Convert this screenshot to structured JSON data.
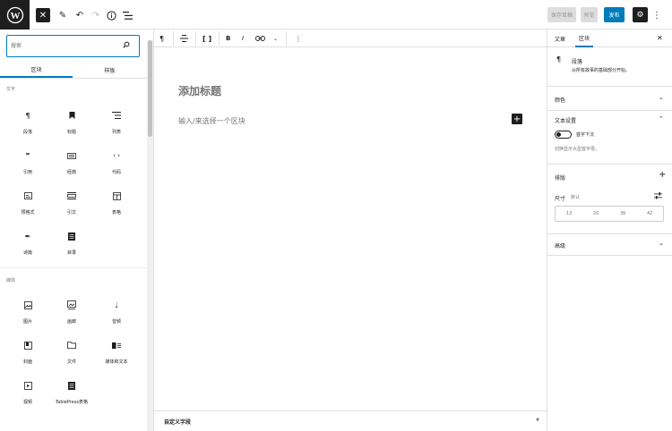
{
  "toolbar": {
    "save_draft": "保存草稿",
    "preview": "预览",
    "publish": "发布",
    "accent": "#007cba"
  },
  "inserter": {
    "search_placeholder": "搜索",
    "tabs": [
      "区块",
      "样板"
    ],
    "categories": [
      "文字",
      "媒体"
    ],
    "text_blocks": [
      {
        "label": "段落",
        "icon": "paragraph-icon"
      },
      {
        "label": "标题",
        "icon": "bookmark-icon"
      },
      {
        "label": "列表",
        "icon": "list-icon"
      },
      {
        "label": "引用",
        "icon": "quote-icon"
      },
      {
        "label": "经典",
        "icon": "keyboard-icon"
      },
      {
        "label": "代码",
        "icon": "code-icon"
      },
      {
        "label": "预格式",
        "icon": "preformatted-icon"
      },
      {
        "label": "引文",
        "icon": "pullquote-icon"
      },
      {
        "label": "表格",
        "icon": "table-icon"
      },
      {
        "label": "诗篇",
        "icon": "verse-icon"
      },
      {
        "label": "目录",
        "icon": "toc-icon"
      }
    ],
    "media_blocks": [
      {
        "label": "图片",
        "icon": "image-icon"
      },
      {
        "label": "画廊",
        "icon": "gallery-icon"
      },
      {
        "label": "音频",
        "icon": "audio-icon"
      },
      {
        "label": "封面",
        "icon": "cover-icon"
      },
      {
        "label": "文件",
        "icon": "file-icon"
      },
      {
        "label": "媒体和文本",
        "icon": "media-text-icon"
      },
      {
        "label": "视频",
        "icon": "video-icon"
      },
      {
        "label": "TablePress表格",
        "icon": "tablepress-icon"
      }
    ]
  },
  "editor": {
    "title_placeholder": "添加标题",
    "block_placeholder": "输入/来选择一个区块",
    "meta_box_title": "自定义字段"
  },
  "sidebar": {
    "tabs": [
      "文章",
      "区块"
    ],
    "block_name": "段落",
    "block_desc": "从所有故事的基础部分开始。",
    "panels": {
      "color": "颜色",
      "text_settings": "文本设置",
      "drop_cap": "首字下沉",
      "drop_cap_help": "切换显示大型首字母。",
      "typography": "排版",
      "size_label": "尺寸",
      "size_default": "默认",
      "advanced": "高级"
    },
    "font_sizes": [
      "13",
      "20",
      "36",
      "42"
    ]
  }
}
